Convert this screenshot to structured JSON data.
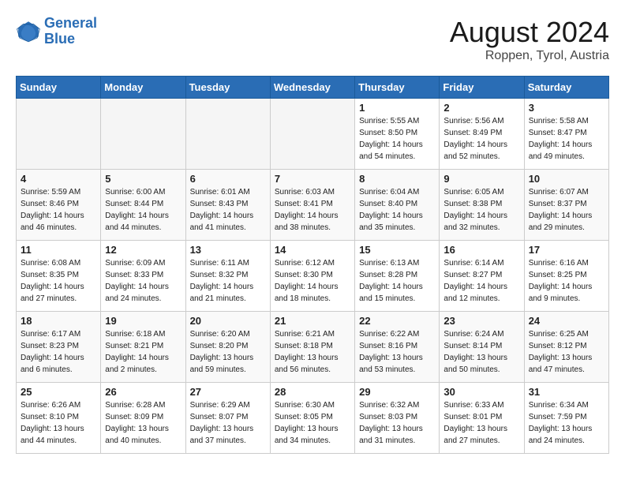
{
  "header": {
    "logo_line1": "General",
    "logo_line2": "Blue",
    "title": "August 2024",
    "subtitle": "Roppen, Tyrol, Austria"
  },
  "weekdays": [
    "Sunday",
    "Monday",
    "Tuesday",
    "Wednesday",
    "Thursday",
    "Friday",
    "Saturday"
  ],
  "weeks": [
    [
      {
        "day": "",
        "empty": true
      },
      {
        "day": "",
        "empty": true
      },
      {
        "day": "",
        "empty": true
      },
      {
        "day": "",
        "empty": true
      },
      {
        "day": "1",
        "sunrise": "5:55 AM",
        "sunset": "8:50 PM",
        "daylight": "14 hours and 54 minutes."
      },
      {
        "day": "2",
        "sunrise": "5:56 AM",
        "sunset": "8:49 PM",
        "daylight": "14 hours and 52 minutes."
      },
      {
        "day": "3",
        "sunrise": "5:58 AM",
        "sunset": "8:47 PM",
        "daylight": "14 hours and 49 minutes."
      }
    ],
    [
      {
        "day": "4",
        "sunrise": "5:59 AM",
        "sunset": "8:46 PM",
        "daylight": "14 hours and 46 minutes."
      },
      {
        "day": "5",
        "sunrise": "6:00 AM",
        "sunset": "8:44 PM",
        "daylight": "14 hours and 44 minutes."
      },
      {
        "day": "6",
        "sunrise": "6:01 AM",
        "sunset": "8:43 PM",
        "daylight": "14 hours and 41 minutes."
      },
      {
        "day": "7",
        "sunrise": "6:03 AM",
        "sunset": "8:41 PM",
        "daylight": "14 hours and 38 minutes."
      },
      {
        "day": "8",
        "sunrise": "6:04 AM",
        "sunset": "8:40 PM",
        "daylight": "14 hours and 35 minutes."
      },
      {
        "day": "9",
        "sunrise": "6:05 AM",
        "sunset": "8:38 PM",
        "daylight": "14 hours and 32 minutes."
      },
      {
        "day": "10",
        "sunrise": "6:07 AM",
        "sunset": "8:37 PM",
        "daylight": "14 hours and 29 minutes."
      }
    ],
    [
      {
        "day": "11",
        "sunrise": "6:08 AM",
        "sunset": "8:35 PM",
        "daylight": "14 hours and 27 minutes."
      },
      {
        "day": "12",
        "sunrise": "6:09 AM",
        "sunset": "8:33 PM",
        "daylight": "14 hours and 24 minutes."
      },
      {
        "day": "13",
        "sunrise": "6:11 AM",
        "sunset": "8:32 PM",
        "daylight": "14 hours and 21 minutes."
      },
      {
        "day": "14",
        "sunrise": "6:12 AM",
        "sunset": "8:30 PM",
        "daylight": "14 hours and 18 minutes."
      },
      {
        "day": "15",
        "sunrise": "6:13 AM",
        "sunset": "8:28 PM",
        "daylight": "14 hours and 15 minutes."
      },
      {
        "day": "16",
        "sunrise": "6:14 AM",
        "sunset": "8:27 PM",
        "daylight": "14 hours and 12 minutes."
      },
      {
        "day": "17",
        "sunrise": "6:16 AM",
        "sunset": "8:25 PM",
        "daylight": "14 hours and 9 minutes."
      }
    ],
    [
      {
        "day": "18",
        "sunrise": "6:17 AM",
        "sunset": "8:23 PM",
        "daylight": "14 hours and 6 minutes."
      },
      {
        "day": "19",
        "sunrise": "6:18 AM",
        "sunset": "8:21 PM",
        "daylight": "14 hours and 2 minutes."
      },
      {
        "day": "20",
        "sunrise": "6:20 AM",
        "sunset": "8:20 PM",
        "daylight": "13 hours and 59 minutes."
      },
      {
        "day": "21",
        "sunrise": "6:21 AM",
        "sunset": "8:18 PM",
        "daylight": "13 hours and 56 minutes."
      },
      {
        "day": "22",
        "sunrise": "6:22 AM",
        "sunset": "8:16 PM",
        "daylight": "13 hours and 53 minutes."
      },
      {
        "day": "23",
        "sunrise": "6:24 AM",
        "sunset": "8:14 PM",
        "daylight": "13 hours and 50 minutes."
      },
      {
        "day": "24",
        "sunrise": "6:25 AM",
        "sunset": "8:12 PM",
        "daylight": "13 hours and 47 minutes."
      }
    ],
    [
      {
        "day": "25",
        "sunrise": "6:26 AM",
        "sunset": "8:10 PM",
        "daylight": "13 hours and 44 minutes."
      },
      {
        "day": "26",
        "sunrise": "6:28 AM",
        "sunset": "8:09 PM",
        "daylight": "13 hours and 40 minutes."
      },
      {
        "day": "27",
        "sunrise": "6:29 AM",
        "sunset": "8:07 PM",
        "daylight": "13 hours and 37 minutes."
      },
      {
        "day": "28",
        "sunrise": "6:30 AM",
        "sunset": "8:05 PM",
        "daylight": "13 hours and 34 minutes."
      },
      {
        "day": "29",
        "sunrise": "6:32 AM",
        "sunset": "8:03 PM",
        "daylight": "13 hours and 31 minutes."
      },
      {
        "day": "30",
        "sunrise": "6:33 AM",
        "sunset": "8:01 PM",
        "daylight": "13 hours and 27 minutes."
      },
      {
        "day": "31",
        "sunrise": "6:34 AM",
        "sunset": "7:59 PM",
        "daylight": "13 hours and 24 minutes."
      }
    ]
  ]
}
